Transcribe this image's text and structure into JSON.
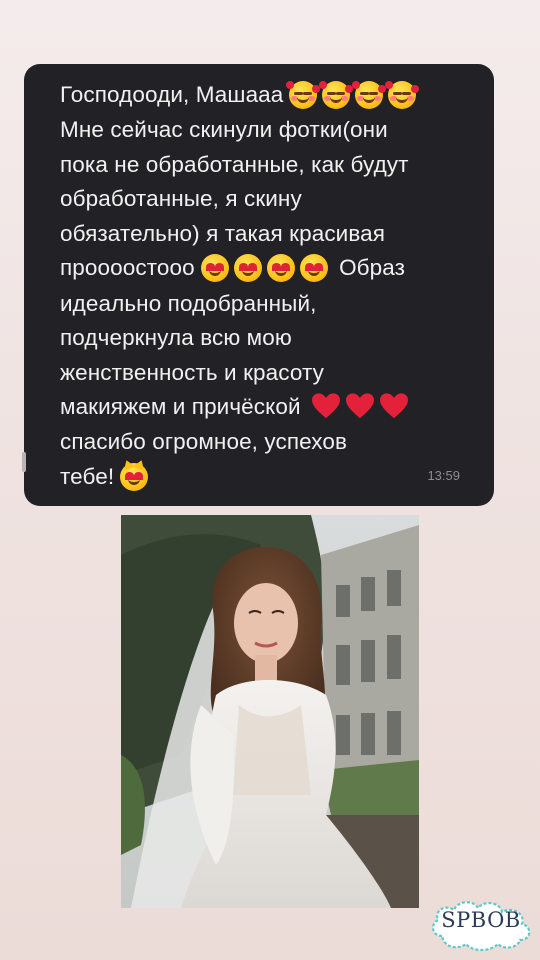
{
  "message": {
    "lines": [
      "Господооди, Машааа",
      "Мне сейчас скинули фотки(они",
      "пока не обработанные, как будут",
      "обработанные, я скину",
      "обязательно) я такая красивая",
      "проооостооо",
      "Образ",
      "идеально подобранный,",
      "подчеркнула всю мою",
      "женственность и красоту",
      "макияжем и причёской",
      "спасибо огромное, успехов",
      "тебе!"
    ],
    "time": "13:59",
    "emoji": {
      "line1": [
        "smiling-face-with-hearts-icon",
        "smiling-face-with-hearts-icon",
        "smiling-face-with-hearts-icon",
        "smiling-face-with-hearts-icon"
      ],
      "line6": [
        "heart-eyes-face-icon",
        "heart-eyes-face-icon",
        "heart-eyes-face-icon",
        "heart-eyes-face-icon"
      ],
      "line11": [
        "red-heart-icon",
        "red-heart-icon",
        "red-heart-icon"
      ],
      "line13": [
        "heart-eyes-cat-icon"
      ]
    }
  },
  "watermark": {
    "text": "SPBOB"
  },
  "colors": {
    "bubble_bg": "#222125",
    "text": "#f1f1f1",
    "time": "#8e8d92",
    "background": "#efe3e1",
    "heart": "#e3213b",
    "badge_text": "#2b3a57",
    "badge_outline": "#5fc9c9"
  }
}
